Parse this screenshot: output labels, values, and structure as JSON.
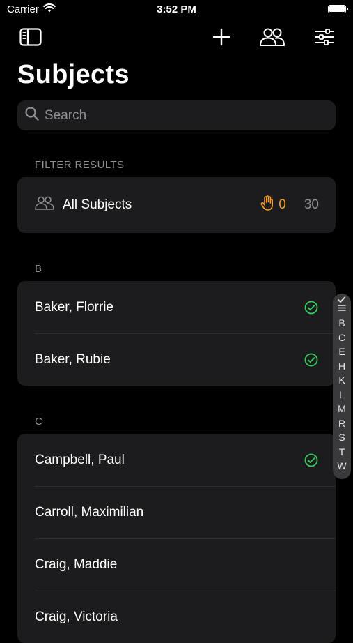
{
  "status_bar": {
    "carrier": "Carrier",
    "time": "3:52 PM"
  },
  "nav": {
    "title": "Subjects"
  },
  "search": {
    "placeholder": "Search"
  },
  "filter": {
    "header": "FILTER RESULTS",
    "all_subjects_label": "All Subjects",
    "raised_hand_count": "0",
    "total_count": "30"
  },
  "sections": [
    {
      "letter": "B",
      "items": [
        {
          "name": "Baker, Florrie",
          "checked": true
        },
        {
          "name": "Baker, Rubie",
          "checked": true
        }
      ]
    },
    {
      "letter": "C",
      "items": [
        {
          "name": "Campbell, Paul",
          "checked": true
        },
        {
          "name": "Carroll, Maximilian",
          "checked": false
        },
        {
          "name": "Craig, Maddie",
          "checked": false
        },
        {
          "name": "Craig, Victoria",
          "checked": false
        }
      ]
    }
  ],
  "index_letters": [
    "B",
    "C",
    "E",
    "H",
    "K",
    "L",
    "M",
    "R",
    "S",
    "T",
    "W"
  ],
  "colors": {
    "accent_orange": "#ff9f0a",
    "check_green": "#30d158",
    "secondary_text": "#8e8e93"
  }
}
